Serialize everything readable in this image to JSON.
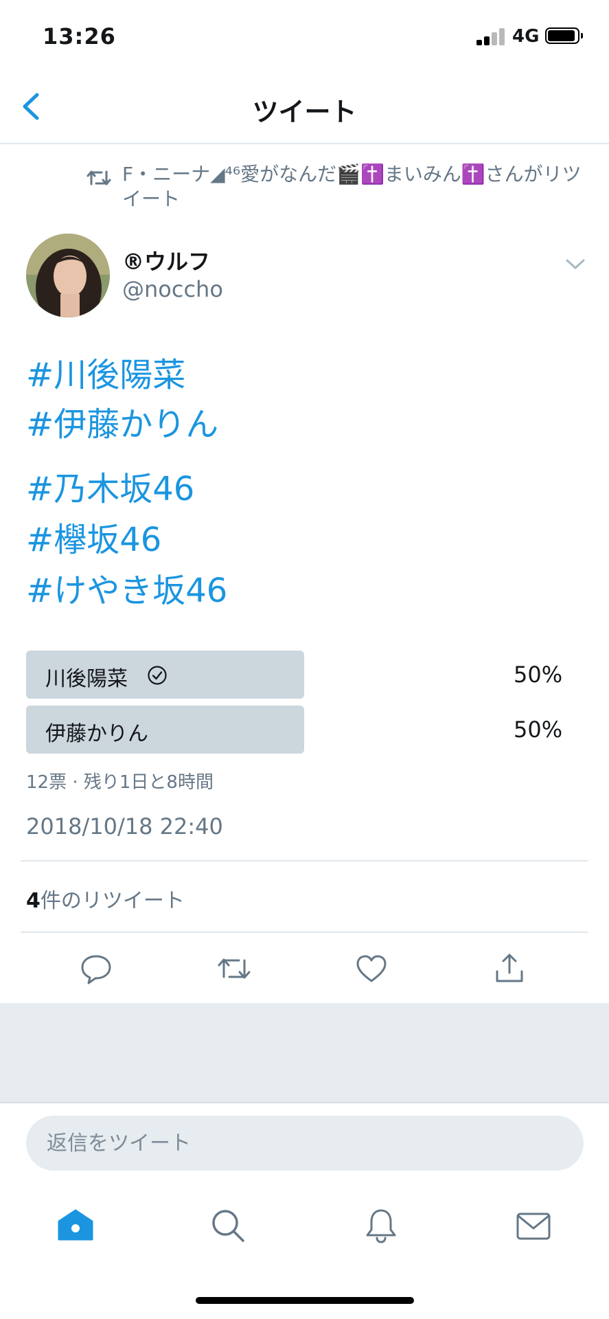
{
  "status_bar": {
    "time": "13:26",
    "network": "4G"
  },
  "header": {
    "title": "ツイート"
  },
  "retweet_context": {
    "text": "F・ニーナ◢⁴⁶愛がなんだ🎬✝️まいみん✝️さんがリツイート"
  },
  "author": {
    "name": "®ウルフ",
    "handle": "@noccho"
  },
  "tweet": {
    "hashtags": [
      "#川後陽菜",
      "#伊藤かりん",
      "#乃木坂46",
      "#欅坂46",
      "#けやき坂46"
    ]
  },
  "poll": {
    "options": [
      {
        "label": "川後陽菜",
        "percent": "50%",
        "selected": true
      },
      {
        "label": "伊藤かりん",
        "percent": "50%",
        "selected": false
      }
    ],
    "meta": "12票 · 残り1日と8時間"
  },
  "timestamp": "2018/10/18 22:40",
  "retweets": {
    "count": "4",
    "label": "件のリツイート"
  },
  "actions": [
    "reply-icon",
    "retweet-icon",
    "like-icon",
    "share-icon"
  ],
  "composer": {
    "placeholder": "返信をツイート"
  },
  "tab_bar": [
    "home-icon",
    "search-icon",
    "notifications-icon",
    "messages-icon"
  ],
  "colors": {
    "accent": "#1b95e0",
    "muted": "#657786",
    "poll_bar": "#ccd6dd"
  }
}
